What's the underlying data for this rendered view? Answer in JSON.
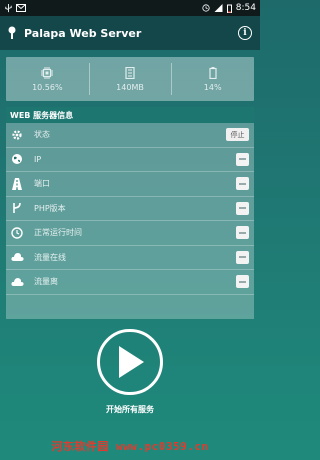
{
  "status_bar": {
    "time": "8:54",
    "battery_fill": 0.15
  },
  "app_bar": {
    "title": "Palapa Web Server",
    "info_icon": "info-icon"
  },
  "stats": [
    {
      "icon": "cpu-icon",
      "value": "10.56%"
    },
    {
      "icon": "memory-icon",
      "value": "140MB"
    },
    {
      "icon": "battery-icon",
      "value": "14%"
    }
  ],
  "panel": {
    "header": "WEB 服务器信息",
    "rows": [
      {
        "icon": "gear-icon",
        "label": "状态",
        "action": "停止"
      },
      {
        "icon": "globe-icon",
        "label": "IP"
      },
      {
        "icon": "road-icon",
        "label": "端口"
      },
      {
        "icon": "fork-icon",
        "label": "PHP版本"
      },
      {
        "icon": "clock-icon",
        "label": "正常运行时间"
      },
      {
        "icon": "cloud-icon",
        "label": "流量在线"
      },
      {
        "icon": "cloud-icon",
        "label": "流量离"
      }
    ]
  },
  "start": {
    "label": "开始所有服务"
  },
  "watermark": "河东软件园 www.pc0359.cn",
  "colors": {
    "app_bar": "#13474a",
    "panel_header": "#1d7770",
    "watermark": "#e23b2e"
  }
}
